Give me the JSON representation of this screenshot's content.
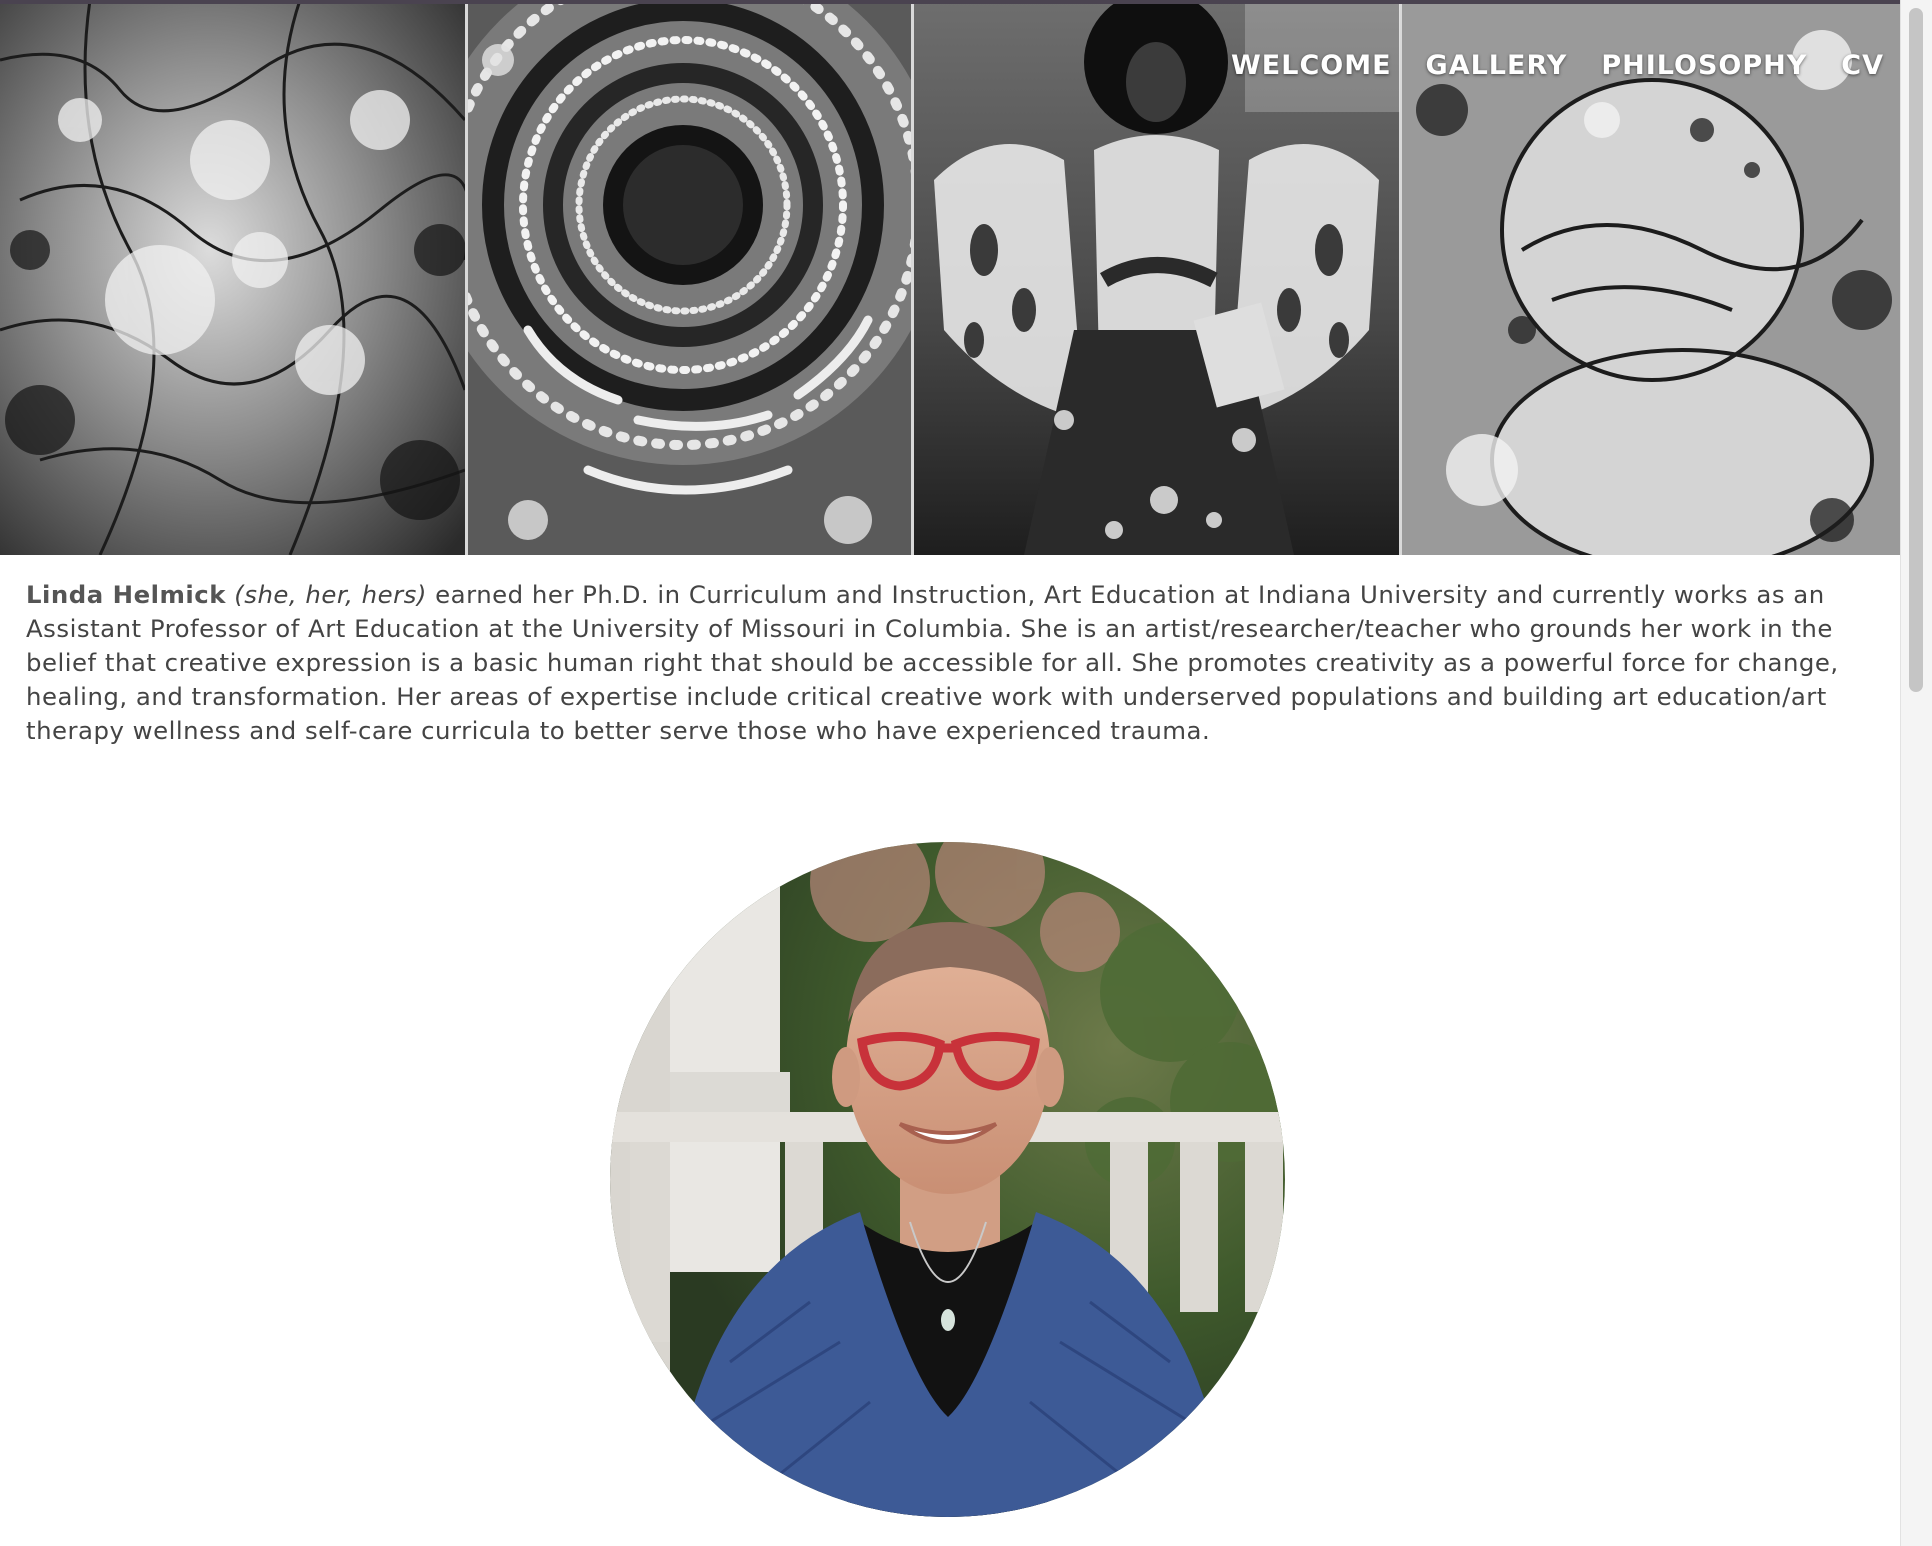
{
  "nav": {
    "items": [
      {
        "label": "WELCOME"
      },
      {
        "label": "GALLERY"
      },
      {
        "label": "PHILOSOPHY"
      },
      {
        "label": "CV"
      }
    ]
  },
  "hero": {
    "panels": [
      {
        "image": "crackled-texture-artwork"
      },
      {
        "image": "circular-spiral-artwork"
      },
      {
        "image": "figure-with-hat-artwork"
      },
      {
        "image": "organic-cells-artwork"
      }
    ],
    "style": "black-and-white"
  },
  "bio": {
    "name": "Linda Helmick",
    "pronouns": "(she, her, hers)",
    "text": "earned her Ph.D. in Curriculum and Instruction, Art Education at Indiana University and currently works as an Assistant Professor of Art Education at the University of Missouri in Columbia. She is an artist/researcher/teacher who grounds her work in the belief that creative expression is a basic human right that should be accessible for all. She promotes creativity as a powerful force for change, healing, and transformation. Her areas of expertise include critical creative work with underserved populations and building art education/art therapy wellness and self-care curricula to better serve those who have experienced trauma."
  },
  "portrait": {
    "image": "portrait-photo"
  },
  "colors": {
    "text": "#444444",
    "nav_text": "#ffffff",
    "background": "#ffffff",
    "sweater": "#3d5a96",
    "glasses": "#c8323a"
  }
}
